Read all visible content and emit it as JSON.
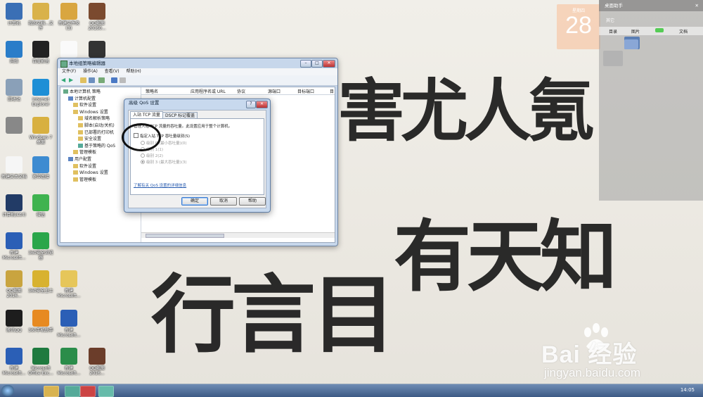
{
  "wallpaper": {
    "line1": "害尤人氪",
    "line2": "有天知",
    "line3": "行言目"
  },
  "desktop_icons": [
    {
      "name": "计算机",
      "color": "#3a6fb5"
    },
    {
      "name": "我的文档...文件",
      "color": "#d9b24a"
    },
    {
      "name": "新建文件夹(3)",
      "color": "#d9a640"
    },
    {
      "name": "QQ截图20160...",
      "color": "#7b4a2f"
    },
    {
      "name": "网络",
      "color": "#2a7dc9"
    },
    {
      "name": "百度影音",
      "color": "#222"
    },
    {
      "name": "",
      "color": "#fafafa"
    },
    {
      "name": "",
      "color": "#333"
    },
    {
      "name": "回收站",
      "color": "#8aa0b8"
    },
    {
      "name": "Internet Explorer",
      "color": "#1e8fd6"
    },
    {
      "name": "",
      "color": "#888"
    },
    {
      "name": "Windows 7桌面",
      "color": "#d8b040"
    },
    {
      "name": "新建文本文档",
      "color": "#f6f6f6"
    },
    {
      "name": "宽带连接",
      "color": "#3d8bd1"
    },
    {
      "name": "计算机(Ctrl)",
      "color": "#223b66"
    },
    {
      "name": "微信",
      "color": "#3fb34f"
    },
    {
      "name": "新建Microsoft...",
      "color": "#2b5fb6"
    },
    {
      "name": "360安全浏览器",
      "color": "#2aa64a"
    },
    {
      "name": "QQ截图2016...",
      "color": "#c9a43f"
    },
    {
      "name": "360安全卫士",
      "color": "#d8b230"
    },
    {
      "name": "新建Microsoft...",
      "color": "#e6c65a"
    },
    {
      "name": "腾讯QQ",
      "color": "#1d1d1d"
    },
    {
      "name": "360手机助手",
      "color": "#e78a21"
    },
    {
      "name": "新建Microsoft...",
      "color": "#2b5fb6"
    },
    {
      "name": "新建Microsoft...",
      "color": "#2b5fb6"
    },
    {
      "name": "Microsoft Office Exc...",
      "color": "#1f7a3f"
    },
    {
      "name": "新建Microsoft...",
      "color": "#2b8d4a"
    },
    {
      "name": "QQ截图2016...",
      "color": "#6b3d2a"
    }
  ],
  "gpedit": {
    "title": "本地组策略编辑器",
    "menu": [
      "文件(F)",
      "操作(A)",
      "查看(V)",
      "帮助(H)"
    ],
    "tree": [
      "本地计算机 策略",
      "计算机配置",
      "软件设置",
      "Windows 设置",
      "域名解析策略",
      "脚本(启动/关机)",
      "已部署的打印机",
      "安全设置",
      "基于策略的 QoS",
      "管理模板",
      "用户配置",
      "软件设置",
      "Windows 设置",
      "管理模板"
    ],
    "columns": [
      "策略名",
      "应用程序名或 URL",
      "协议",
      "源端口",
      "目标端口",
      "目"
    ]
  },
  "qos_dialog": {
    "title": "高级 QoS 设置",
    "tabs": [
      "入站 TCP 流量",
      "DSCP 标记覆盖"
    ],
    "description": "管理入站 TCP 流量的吞吐量。此设置应用于整个计算机。",
    "checkbox_label": "指定入站 TCP 吞吐量级别(S)",
    "levels": [
      "级别 0 (最小吞吐量)(0)",
      "级别 1(1)",
      "级别 2(2)",
      "级别 3 (最大吞吐量)(3)"
    ],
    "selected_level": 3,
    "help_link": "了解有关 QoS 设置的详细信息",
    "buttons": {
      "ok": "确定",
      "cancel": "取消",
      "help": "帮助"
    }
  },
  "gadget": {
    "title": "桌面助手",
    "calendar_label": "星期四",
    "calendar_day": "28",
    "section": "其它",
    "tabs": [
      "目录",
      "图片",
      "文档"
    ]
  },
  "taskbar": {
    "time": "14:05"
  },
  "watermark": {
    "brand": "Bai 经验",
    "url": "jingyan.baidu.com"
  }
}
